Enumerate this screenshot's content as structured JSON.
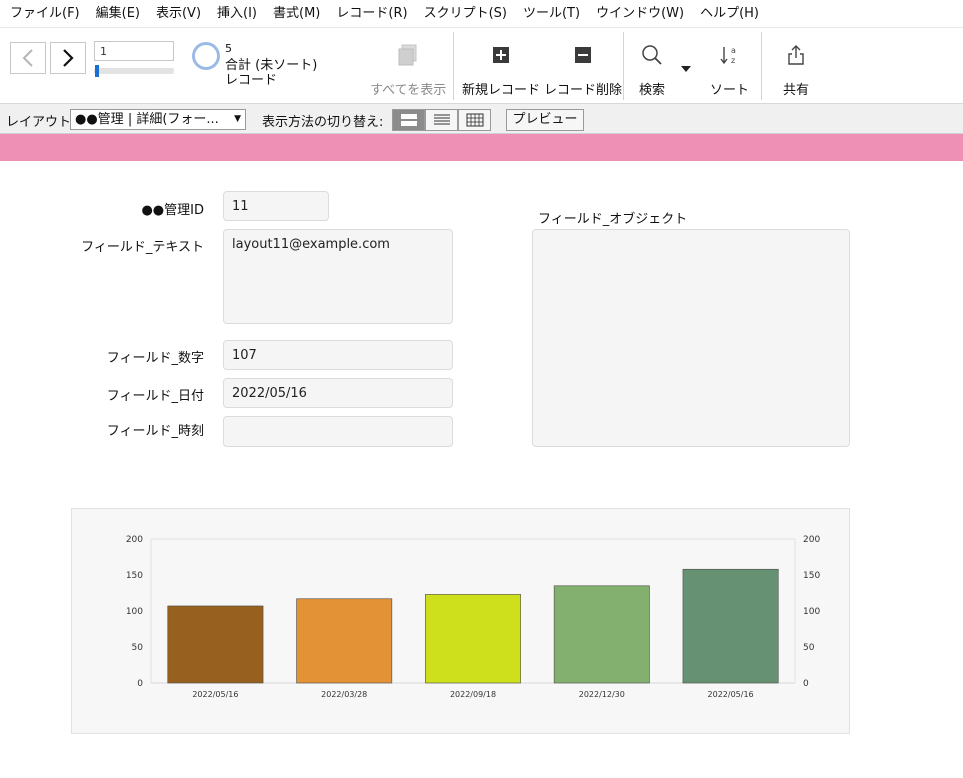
{
  "menu": [
    "ファイル(F)",
    "編集(E)",
    "表示(V)",
    "挿入(I)",
    "書式(M)",
    "レコード(R)",
    "スクリプト(S)",
    "ツール(T)",
    "ウインドウ(W)",
    "ヘルプ(H)"
  ],
  "toolbar": {
    "record_number": "1",
    "record_count": "5",
    "record_status_1": "合計 (未ソート)",
    "record_status_2": "レコード",
    "show_all": "すべてを表示",
    "new_record": "新規レコード",
    "delete_record": "レコード削除",
    "find": "検索",
    "sort": "ソート",
    "share": "共有"
  },
  "layoutbar": {
    "layout_label": "レイアウト:",
    "layout_value": "●●管理 | 詳細(フォー...",
    "view_label": "表示方法の切り替え:",
    "preview": "プレビュー"
  },
  "form": {
    "id_label": "●●管理ID",
    "id_value": "11",
    "text_label": "フィールド_テキスト",
    "text_value": "layout11@example.com",
    "number_label": "フィールド_数字",
    "number_value": "107",
    "date_label": "フィールド_日付",
    "date_value": "2022/05/16",
    "time_label": "フィールド_時刻",
    "time_value": "",
    "object_label": "フィールド_オブジェクト"
  },
  "colors": {
    "header_band": "#ee8fb5",
    "bars": [
      "#98601e",
      "#e39235",
      "#cedf1c",
      "#84b06f",
      "#669172"
    ]
  },
  "chart_data": {
    "type": "bar",
    "categories": [
      "2022/05/16",
      "2022/03/28",
      "2022/09/18",
      "2022/12/30",
      "2022/05/16"
    ],
    "values": [
      107,
      117,
      123,
      135,
      158
    ],
    "ylim": [
      0,
      200
    ],
    "yticks": [
      0,
      50,
      100,
      150,
      200
    ],
    "ytick_labels": [
      "0",
      "50",
      "100",
      "150",
      "200"
    ],
    "secondary_axis": true,
    "grid": false,
    "legend": "none"
  }
}
